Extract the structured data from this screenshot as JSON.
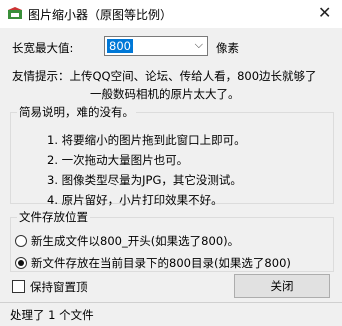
{
  "window": {
    "title": "图片缩小器（原图等比例）",
    "close": "✕"
  },
  "size": {
    "label": "长宽最大值:",
    "value": "800",
    "unit": "像素"
  },
  "tip": {
    "line1": "友情提示：上传QQ空间、论坛、传给人看，800边长就够了",
    "line2": "一般数码相机的原片太大了。"
  },
  "description": {
    "legend": "简易说明，难的没有。",
    "lines": [
      "1. 将要缩小的图片拖到此窗口上即可。",
      "2. 一次拖动大量图片也可。",
      "3. 图像类型尽量为JPG，其它没测试。",
      "4. 原片留好，小片打印效果不好。"
    ]
  },
  "save_location": {
    "legend": "文件存放位置",
    "options": [
      {
        "label": "新生成文件以800_开头(如果选了800)。",
        "selected": false
      },
      {
        "label": "新文件存放在当前目录下的800目录(如果选了800)",
        "selected": true
      }
    ]
  },
  "keep_on_top": {
    "label": "保持窗置顶",
    "checked": false
  },
  "close_button": {
    "label": "关闭"
  },
  "status": {
    "text": "处理了 1 个文件"
  }
}
